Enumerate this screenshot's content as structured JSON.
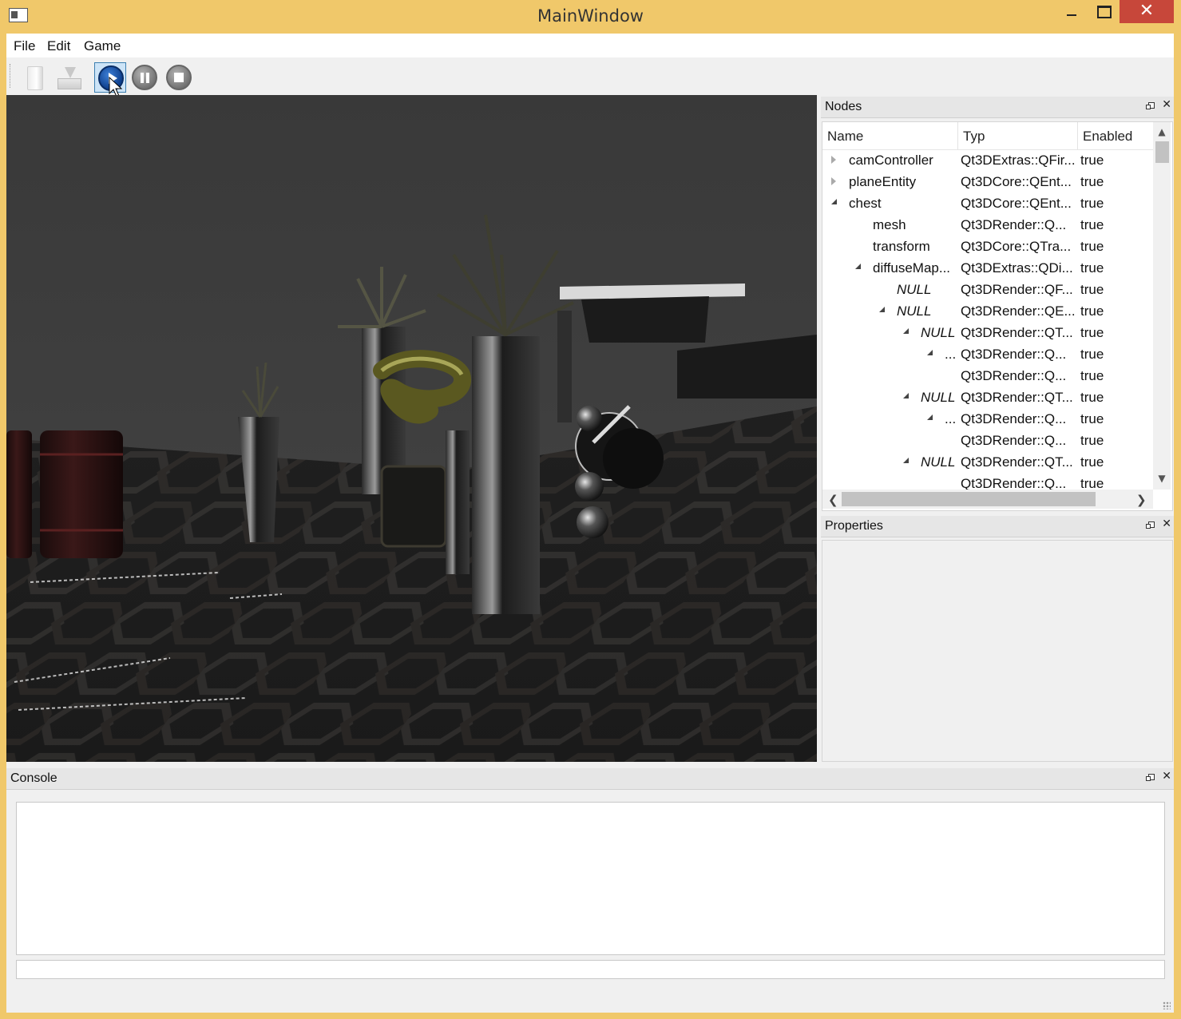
{
  "window": {
    "title": "MainWindow",
    "close_glyph": "✕"
  },
  "menu": {
    "items": [
      "File",
      "Edit",
      "Game"
    ]
  },
  "toolbar": {
    "buttons": [
      {
        "name": "new-document-icon",
        "state": "disabled"
      },
      {
        "name": "save-icon",
        "state": "disabled"
      },
      {
        "name": "play-icon",
        "state": "active"
      },
      {
        "name": "pause-icon",
        "state": "normal"
      },
      {
        "name": "stop-icon",
        "state": "normal"
      }
    ]
  },
  "nodes_panel": {
    "title": "Nodes",
    "columns": [
      "Name",
      "Typ",
      "Enabled"
    ],
    "rows": [
      {
        "name": "camController",
        "type": "Qt3DExtras::QFir...",
        "enabled": "true",
        "expander": "closed",
        "depth": 0,
        "italic": false
      },
      {
        "name": "planeEntity",
        "type": "Qt3DCore::QEnt...",
        "enabled": "true",
        "expander": "closed",
        "depth": 0,
        "italic": false
      },
      {
        "name": "chest",
        "type": "Qt3DCore::QEnt...",
        "enabled": "true",
        "expander": "open",
        "depth": 0,
        "italic": false
      },
      {
        "name": "mesh",
        "type": "Qt3DRender::Q...",
        "enabled": "true",
        "expander": "none",
        "depth": 1,
        "italic": false
      },
      {
        "name": "transform",
        "type": "Qt3DCore::QTra...",
        "enabled": "true",
        "expander": "none",
        "depth": 1,
        "italic": false
      },
      {
        "name": "diffuseMap...",
        "type": "Qt3DExtras::QDi...",
        "enabled": "true",
        "expander": "open",
        "depth": 1,
        "italic": false
      },
      {
        "name": "NULL",
        "type": "Qt3DRender::QF...",
        "enabled": "true",
        "expander": "none",
        "depth": 2,
        "italic": true
      },
      {
        "name": "NULL",
        "type": "Qt3DRender::QE...",
        "enabled": "true",
        "expander": "open",
        "depth": 2,
        "italic": true
      },
      {
        "name": "NULL",
        "type": "Qt3DRender::QT...",
        "enabled": "true",
        "expander": "open",
        "depth": 3,
        "italic": true
      },
      {
        "name": "...",
        "type": "Qt3DRender::Q...",
        "enabled": "true",
        "expander": "open",
        "depth": 4,
        "italic": false
      },
      {
        "name": "",
        "type": "Qt3DRender::Q...",
        "enabled": "true",
        "expander": "none",
        "depth": 4,
        "italic": false
      },
      {
        "name": "NULL",
        "type": "Qt3DRender::QT...",
        "enabled": "true",
        "expander": "open",
        "depth": 3,
        "italic": true
      },
      {
        "name": "...",
        "type": "Qt3DRender::Q...",
        "enabled": "true",
        "expander": "open",
        "depth": 4,
        "italic": false
      },
      {
        "name": "",
        "type": "Qt3DRender::Q...",
        "enabled": "true",
        "expander": "none",
        "depth": 4,
        "italic": false
      },
      {
        "name": "NULL",
        "type": "Qt3DRender::QT...",
        "enabled": "true",
        "expander": "open",
        "depth": 3,
        "italic": true
      },
      {
        "name": "",
        "type": "Qt3DRender::Q...",
        "enabled": "true",
        "expander": "none",
        "depth": 4,
        "italic": false
      }
    ]
  },
  "properties_panel": {
    "title": "Properties"
  },
  "console_panel": {
    "title": "Console",
    "output": "",
    "input": ""
  },
  "scrollbar": {
    "up": "▲",
    "down": "▼",
    "left": "❮",
    "right": "❯"
  },
  "colors": {
    "title_bar": "#f0c86a",
    "close_button": "#c7473a",
    "active_tool": "#cde4f7",
    "viewport_sky": "#3a3a3a",
    "floor": "#1e1e1e"
  }
}
